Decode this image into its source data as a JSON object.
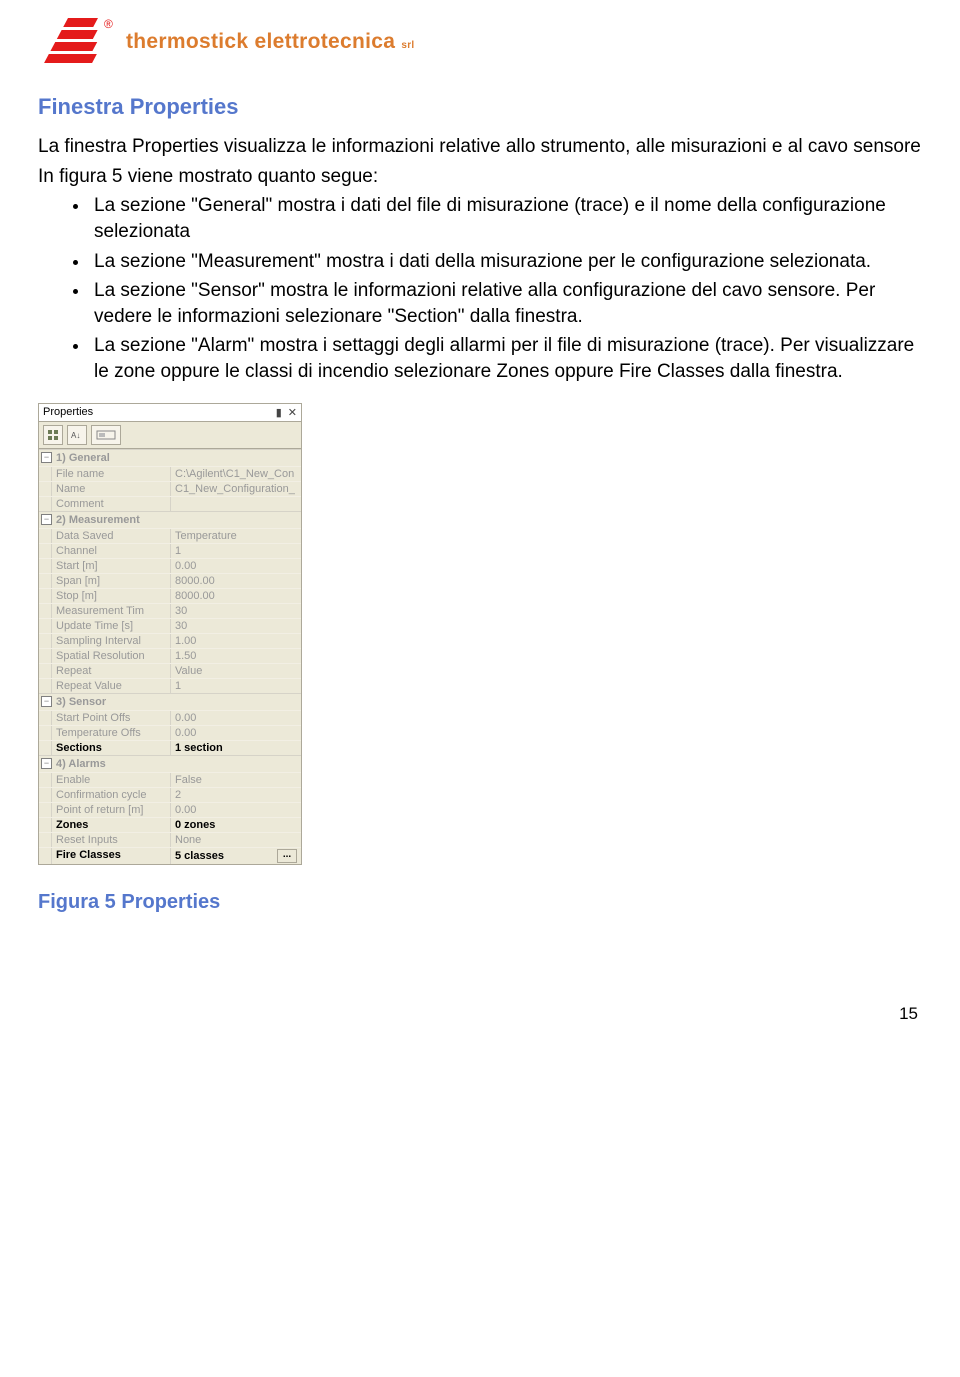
{
  "logo": {
    "brand_text": "thermostick elettrotecnica",
    "suffix": "srl"
  },
  "heading": "Finestra Properties",
  "intro_line1": "La finestra Properties visualizza le informazioni relative allo strumento, alle misurazioni e al cavo sensore",
  "intro_line2": "In figura 5 viene mostrato quanto segue:",
  "bullets": [
    "La sezione \"General\" mostra i dati del file di misurazione (trace) e il nome della configurazione selezionata",
    "La sezione \"Measurement\" mostra i dati della misurazione per le configurazione selezionata.",
    "La sezione \"Sensor\"  mostra le informazioni relative alla configurazione del cavo sensore. Per vedere le informazioni selezionare \"Section\"  dalla finestra.",
    "La sezione \"Alarm\" mostra i settaggi degli allarmi per il file di misurazione (trace). Per visualizzare le zone oppure le classi di incendio selezionare Zones oppure Fire Classes dalla finestra."
  ],
  "panel": {
    "title": "Properties",
    "groups": [
      {
        "name": "1) General",
        "rows": [
          {
            "k": "File name",
            "v": "C:\\Agilent\\C1_New_Con"
          },
          {
            "k": "Name",
            "v": "C1_New_Configuration_"
          },
          {
            "k": "Comment",
            "v": ""
          }
        ]
      },
      {
        "name": "2) Measurement",
        "rows": [
          {
            "k": "Data Saved",
            "v": "Temperature"
          },
          {
            "k": "Channel",
            "v": "1"
          },
          {
            "k": "Start [m]",
            "v": "0.00"
          },
          {
            "k": "Span [m]",
            "v": "8000.00"
          },
          {
            "k": "Stop [m]",
            "v": "8000.00"
          },
          {
            "k": "Measurement Tim",
            "v": "30"
          },
          {
            "k": "Update Time [s]",
            "v": "30"
          },
          {
            "k": "Sampling Interval",
            "v": "1.00"
          },
          {
            "k": "Spatial Resolution",
            "v": "1.50"
          },
          {
            "k": "Repeat",
            "v": "Value"
          },
          {
            "k": "Repeat Value",
            "v": "1"
          }
        ]
      },
      {
        "name": "3) Sensor",
        "rows": [
          {
            "k": "Start Point Offs",
            "v": "0.00"
          },
          {
            "k": "Temperature Offs",
            "v": "0.00"
          },
          {
            "k": "Sections",
            "v": "1 section",
            "black": true
          }
        ]
      },
      {
        "name": "4) Alarms",
        "rows": [
          {
            "k": "Enable",
            "v": "False"
          },
          {
            "k": "Confirmation cycle",
            "v": "2"
          },
          {
            "k": "Point of return [m]",
            "v": "0.00"
          },
          {
            "k": "Zones",
            "v": "0 zones",
            "black": true
          },
          {
            "k": "Reset Inputs",
            "v": "None"
          },
          {
            "k": "Fire Classes",
            "v": "5 classes",
            "black": true,
            "dots": true
          }
        ]
      }
    ]
  },
  "caption": "Figura 5 Properties",
  "page_number": "15"
}
